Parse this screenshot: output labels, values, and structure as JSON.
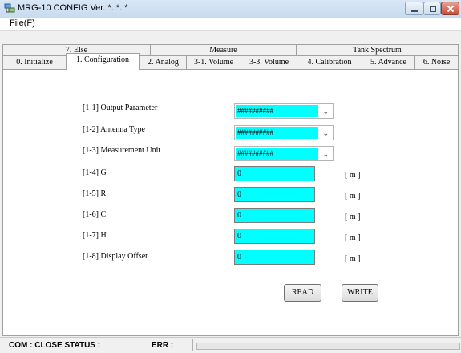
{
  "window": {
    "title": "MRG-10 CONFIG Ver. *. *. *"
  },
  "menu": {
    "file": "File(F)"
  },
  "tabs_top": [
    "7. Else",
    "Measure",
    "Tank Spectrum"
  ],
  "tabs_bottom": [
    "0. Initialize",
    "1. Configuration",
    "2. Analog",
    "3-1. Volume",
    "3-3. Volume",
    "4. Calibration",
    "5. Advance",
    "6. Noise"
  ],
  "form": {
    "output_parameter": {
      "label": "[1-1] Output Parameter",
      "value": "##########"
    },
    "antenna_type": {
      "label": "[1-2] Antenna Type",
      "value": "##########"
    },
    "measurement_unit": {
      "label": "[1-3] Measurement Unit",
      "value": "##########"
    },
    "g": {
      "label": "[1-4] G",
      "value": "0",
      "unit": "[ m ]"
    },
    "r": {
      "label": "[1-5] R",
      "value": "0",
      "unit": "[ m ]"
    },
    "c": {
      "label": "[1-6] C",
      "value": "0",
      "unit": "[ m ]"
    },
    "h": {
      "label": "[1-7] H",
      "value": "0",
      "unit": "[ m ]"
    },
    "display_offset": {
      "label": "[1-8] Display Offset",
      "value": "0",
      "unit": "[ m ]"
    }
  },
  "buttons": {
    "read": "READ",
    "write": "WRITE"
  },
  "status": {
    "com": "COM : CLOSE  STATUS :",
    "err": "ERR :"
  },
  "colors": {
    "field": "#00ffff",
    "titlebar": "#c7dbef",
    "close": "#c74b39"
  },
  "icons": {
    "app": "app-network-icon"
  }
}
